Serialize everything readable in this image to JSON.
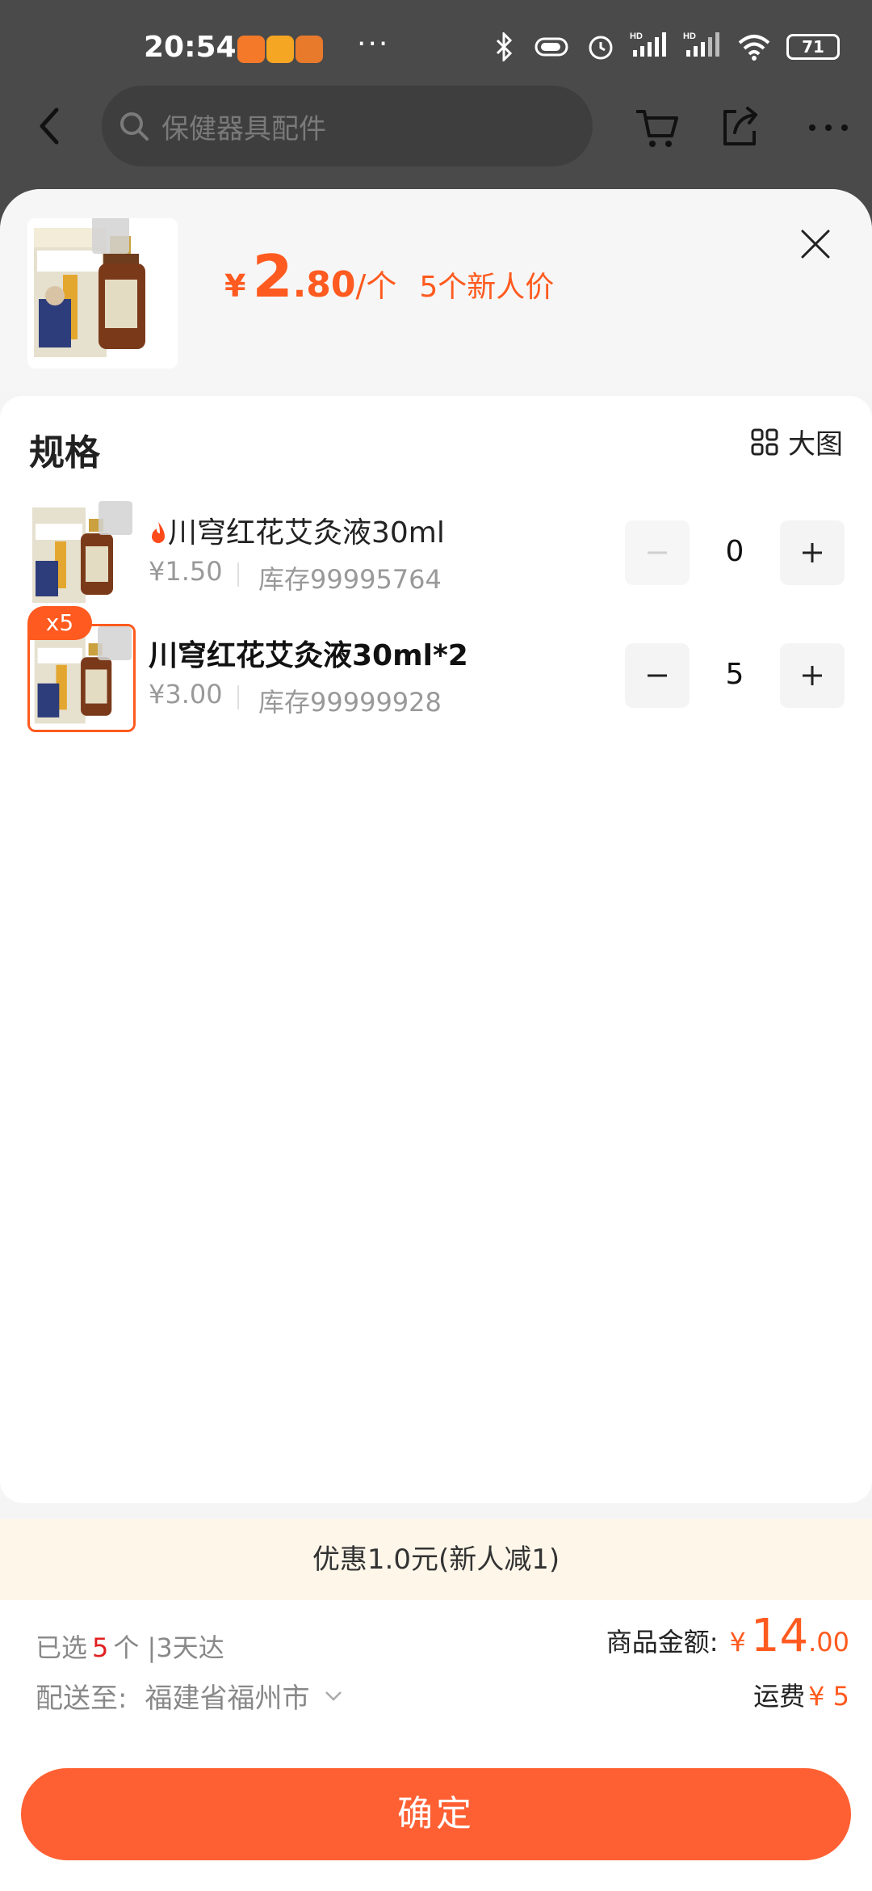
{
  "status_bar": {
    "time": "20:54",
    "more": "···",
    "battery": "71",
    "network": "HD"
  },
  "nav": {
    "search_placeholder": "保健器具配件",
    "icons": [
      "back-icon",
      "search-icon",
      "cart-icon",
      "share-icon",
      "more-icon"
    ]
  },
  "product": {
    "price_currency": "¥",
    "price_int": "2",
    "price_dec": ".80",
    "price_unit": "/个",
    "price_tag": "5个新人价"
  },
  "spec": {
    "title": "规格",
    "big_image_label": "大图",
    "items": [
      {
        "name": "川穹红花艾灸液30ml",
        "price": "¥1.50",
        "stock": "库存99995764",
        "qty": "0",
        "hot": true,
        "selected": false
      },
      {
        "name": "川穹红花艾灸液30ml*2",
        "price": "¥3.00",
        "stock": "库存99999928",
        "qty": "5",
        "badge": "x5",
        "selected": true
      }
    ]
  },
  "promo": {
    "text": "优惠1.0元(新人减1)"
  },
  "summary": {
    "selected_prefix": "已选",
    "selected_count": "5",
    "selected_suffix": "个 |3天达",
    "delivery_label": "配送至:",
    "delivery_address": "福建省福州市",
    "total_label": "商品金额:",
    "total_currency": "¥",
    "total_int": "14",
    "total_dec": ".00",
    "freight_label": "运费",
    "freight_amount": "¥ 5"
  },
  "confirm_label": "确定",
  "colors": {
    "accent": "#ff5a1f",
    "confirm_bg": "#ff6033",
    "promo_bg": "#fdf6e9",
    "overlay": "#4a4a4a"
  }
}
